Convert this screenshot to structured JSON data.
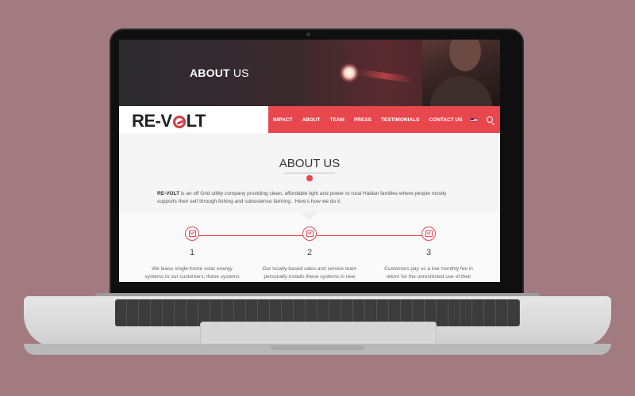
{
  "hero": {
    "title_bold": "ABOUT",
    "title_light": "US"
  },
  "logo": {
    "left": "RE-V",
    "right": "LT"
  },
  "nav": {
    "items": [
      "IMPACT",
      "ABOUT",
      "TEAM",
      "PRESS",
      "TESTIMONIALS",
      "CONTACT US"
    ],
    "search_icon": "search-icon",
    "flag_icon": "us-flag-icon"
  },
  "section": {
    "title": "ABOUT US"
  },
  "intro": {
    "brand": "RE-VOLT",
    "text": " is an off Grid utility company providing  clean, affordable light and power to rural Haitian families where people mostly supports their self through fishing and  subsistence farming .  Here’s how we do it:"
  },
  "steps": [
    {
      "num": "1",
      "text": "We lease single-home solar energy systems to our customers; these systems include a solar"
    },
    {
      "num": "2",
      "text": "Our locally-based sales and service team personally installs these systems in new"
    },
    {
      "num": "3",
      "text": "Customers pay us a low monthly fee in return for the unrestricted use of their systems via a"
    }
  ],
  "colors": {
    "accent": "#e8474d",
    "background": "#a27b80"
  }
}
